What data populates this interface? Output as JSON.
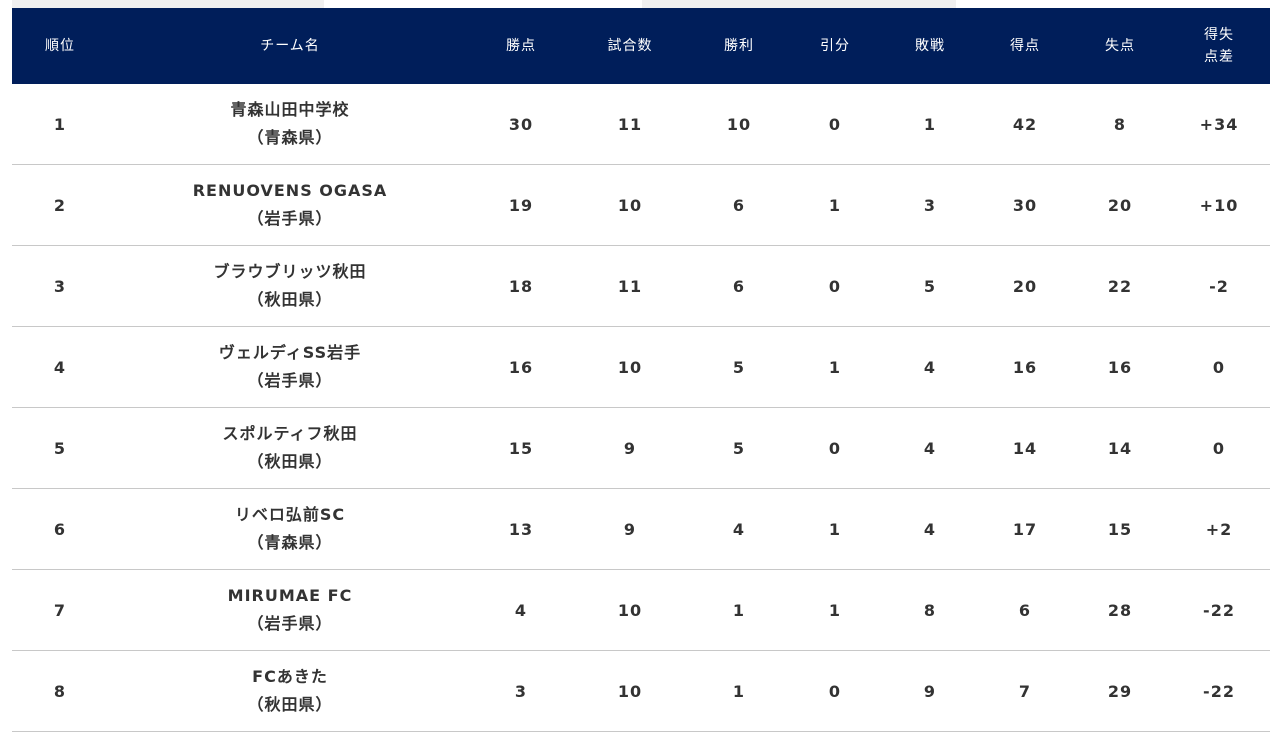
{
  "header": {
    "rank": "順位",
    "team": "チーム名",
    "points": "勝点",
    "played": "試合数",
    "won": "勝利",
    "drawn": "引分",
    "lost": "敗戦",
    "goals_for": "得点",
    "goals_against": "失点",
    "goal_diff": "得失\n点差"
  },
  "colors": {
    "header_bg": "#001e5a",
    "header_text": "#ffffff",
    "row_border": "#c8c8c8",
    "body_text": "#333333"
  },
  "rows": [
    {
      "rank": "1",
      "team": "青森山田中学校",
      "pref": "（青森県）",
      "points": "30",
      "played": "11",
      "won": "10",
      "drawn": "0",
      "lost": "1",
      "goals_for": "42",
      "goals_against": "8",
      "goal_diff": "+34"
    },
    {
      "rank": "2",
      "team": "RENUOVENS OGASA",
      "pref": "（岩手県）",
      "points": "19",
      "played": "10",
      "won": "6",
      "drawn": "1",
      "lost": "3",
      "goals_for": "30",
      "goals_against": "20",
      "goal_diff": "+10"
    },
    {
      "rank": "3",
      "team": "ブラウブリッツ秋田",
      "pref": "（秋田県）",
      "points": "18",
      "played": "11",
      "won": "6",
      "drawn": "0",
      "lost": "5",
      "goals_for": "20",
      "goals_against": "22",
      "goal_diff": "-2"
    },
    {
      "rank": "4",
      "team": "ヴェルディSS岩手",
      "pref": "（岩手県）",
      "points": "16",
      "played": "10",
      "won": "5",
      "drawn": "1",
      "lost": "4",
      "goals_for": "16",
      "goals_against": "16",
      "goal_diff": "0"
    },
    {
      "rank": "5",
      "team": "スポルティフ秋田",
      "pref": "（秋田県）",
      "points": "15",
      "played": "9",
      "won": "5",
      "drawn": "0",
      "lost": "4",
      "goals_for": "14",
      "goals_against": "14",
      "goal_diff": "0"
    },
    {
      "rank": "6",
      "team": "リベロ弘前SC",
      "pref": "（青森県）",
      "points": "13",
      "played": "9",
      "won": "4",
      "drawn": "1",
      "lost": "4",
      "goals_for": "17",
      "goals_against": "15",
      "goal_diff": "+2"
    },
    {
      "rank": "7",
      "team": "MIRUMAE FC",
      "pref": "（岩手県）",
      "points": "4",
      "played": "10",
      "won": "1",
      "drawn": "1",
      "lost": "8",
      "goals_for": "6",
      "goals_against": "28",
      "goal_diff": "-22"
    },
    {
      "rank": "8",
      "team": "FCあきた",
      "pref": "（秋田県）",
      "points": "3",
      "played": "10",
      "won": "1",
      "drawn": "0",
      "lost": "9",
      "goals_for": "7",
      "goals_against": "29",
      "goal_diff": "-22"
    }
  ]
}
